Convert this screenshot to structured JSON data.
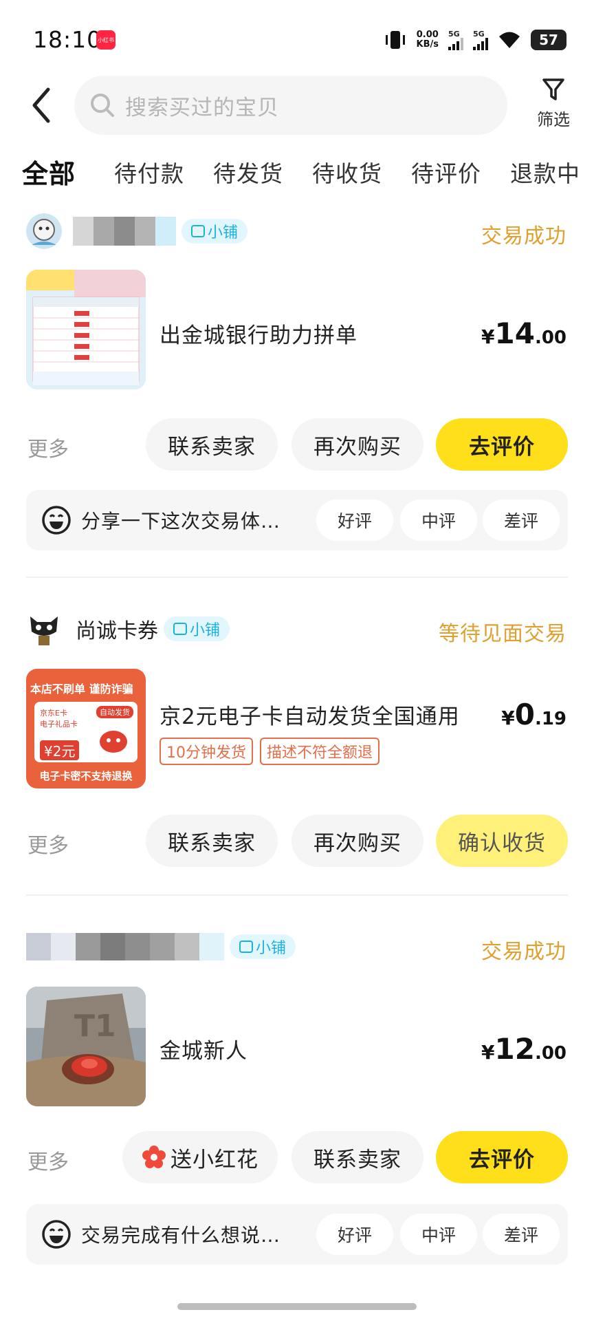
{
  "status_bar": {
    "time": "18:10",
    "app_badge": "小红书",
    "net_speed_value": "0.00",
    "net_speed_unit": "KB/s",
    "signal1_label": "5G",
    "signal2_label": "5G",
    "battery": "57"
  },
  "header": {
    "search_placeholder": "搜索买过的宝贝",
    "filter_label": "筛选"
  },
  "tabs": [
    "全部",
    "待付款",
    "待发货",
    "待收货",
    "待评价",
    "退款中"
  ],
  "orders": [
    {
      "shop_name": "",
      "shop_tag": "小铺",
      "status": "交易成功",
      "title": "出金城银行助力拼单",
      "price_currency": "¥",
      "price_int": "14",
      "price_dec": ".00",
      "tags": [],
      "more_label": "更多",
      "buttons": [
        "联系卖家",
        "再次购买",
        "去评价"
      ],
      "review_prompt": "分享一下这次交易体…",
      "ratings": [
        "好评",
        "中评",
        "差评"
      ]
    },
    {
      "shop_name": "尚诚卡券",
      "shop_tag": "小铺",
      "status": "等待见面交易",
      "title": "京2元电子卡自动发货全国通用",
      "price_currency": "¥",
      "price_int": "0",
      "price_dec": ".19",
      "tags": [
        "10分钟发货",
        "描述不符全额退"
      ],
      "more_label": "更多",
      "buttons": [
        "联系卖家",
        "再次购买",
        "确认收货"
      ],
      "thumb_text": {
        "banner": "本店不刷单 谨防诈骗",
        "card_line1": "京东E卡",
        "card_line2": "电子礼品卡",
        "auto": "自动发货",
        "amount": "¥2元",
        "footer": "电子卡密不支持退换"
      }
    },
    {
      "shop_name": "",
      "shop_tag": "小铺",
      "status": "交易成功",
      "title": "金城新人",
      "price_currency": "¥",
      "price_int": "12",
      "price_dec": ".00",
      "tags": [],
      "more_label": "更多",
      "buttons": [
        "送小红花",
        "联系卖家",
        "去评价"
      ],
      "review_prompt": "交易完成有什么想说…",
      "ratings": [
        "好评",
        "中评",
        "差评"
      ]
    }
  ],
  "colors": {
    "accent_yellow": "#ffde1a",
    "status_orange": "#e0a030",
    "store_tag_blue": "#1ab0e0",
    "tag_red": "#e46e4a"
  },
  "icons": [
    "back-arrow-icon",
    "search-icon",
    "filter-funnel-icon",
    "smile-face-icon",
    "red-flower-icon"
  ]
}
